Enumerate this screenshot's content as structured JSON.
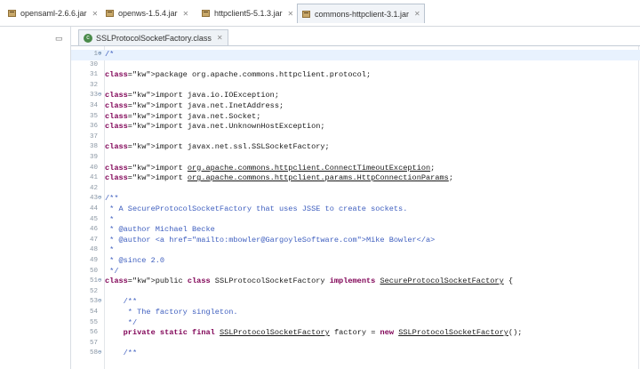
{
  "top_tabs": [
    {
      "label": "opensaml-2.6.6.jar",
      "active": false
    },
    {
      "label": "openws-1.5.4.jar",
      "active": false
    },
    {
      "label": "httpclient5-5.1.3.jar",
      "active": false
    },
    {
      "label": "commons-httpclient-3.1.jar",
      "active": true
    }
  ],
  "editor": {
    "tab_label": "SSLProtocolSocketFactory.class",
    "lines": [
      {
        "n": "1",
        "fold": "⊕",
        "code": "/*",
        "t": "cm"
      },
      {
        "n": "30",
        "code": ""
      },
      {
        "n": "31",
        "code": "package org.apache.commons.httpclient.protocol;"
      },
      {
        "n": "32",
        "code": ""
      },
      {
        "n": "33",
        "fold": "⊖",
        "code": "import java.io.IOException;"
      },
      {
        "n": "34",
        "code": "import java.net.InetAddress;"
      },
      {
        "n": "35",
        "code": "import java.net.Socket;"
      },
      {
        "n": "36",
        "code": "import java.net.UnknownHostException;"
      },
      {
        "n": "37",
        "code": ""
      },
      {
        "n": "38",
        "code": "import javax.net.ssl.SSLSocketFactory;"
      },
      {
        "n": "39",
        "code": ""
      },
      {
        "n": "40",
        "code": "import org.apache.commons.httpclient.ConnectTimeoutException;"
      },
      {
        "n": "41",
        "code": "import org.apache.commons.httpclient.params.HttpConnectionParams;"
      },
      {
        "n": "42",
        "code": ""
      },
      {
        "n": "43",
        "fold": "⊖",
        "code": "/**",
        "t": "cm"
      },
      {
        "n": "44",
        "code": " * A SecureProtocolSocketFactory that uses JSSE to create sockets.",
        "t": "cm"
      },
      {
        "n": "45",
        "code": " *",
        "t": "cm"
      },
      {
        "n": "46",
        "code": " * @author Michael Becke",
        "t": "cm"
      },
      {
        "n": "47",
        "code": " * @author <a href=\"mailto:mbowler@GargoyleSoftware.com\">Mike Bowler</a>",
        "t": "cm"
      },
      {
        "n": "48",
        "code": " *",
        "t": "cm"
      },
      {
        "n": "49",
        "code": " * @since 2.0",
        "t": "cm"
      },
      {
        "n": "50",
        "code": " */",
        "t": "cm"
      },
      {
        "n": "51",
        "fold": "⊖",
        "code": "public class SSLProtocolSocketFactory implements SecureProtocolSocketFactory {"
      },
      {
        "n": "52",
        "code": ""
      },
      {
        "n": "53",
        "fold": "⊖",
        "code": "    /**",
        "t": "cm"
      },
      {
        "n": "54",
        "code": "     * The factory singleton.",
        "t": "cm"
      },
      {
        "n": "55",
        "code": "     */",
        "t": "cm"
      },
      {
        "n": "56",
        "code": "    private static final SSLProtocolSocketFactory factory = new SSLProtocolSocketFactory();"
      },
      {
        "n": "57",
        "code": ""
      },
      {
        "n": "58",
        "fold": "⊖",
        "code": "    /**",
        "t": "cm"
      }
    ]
  }
}
